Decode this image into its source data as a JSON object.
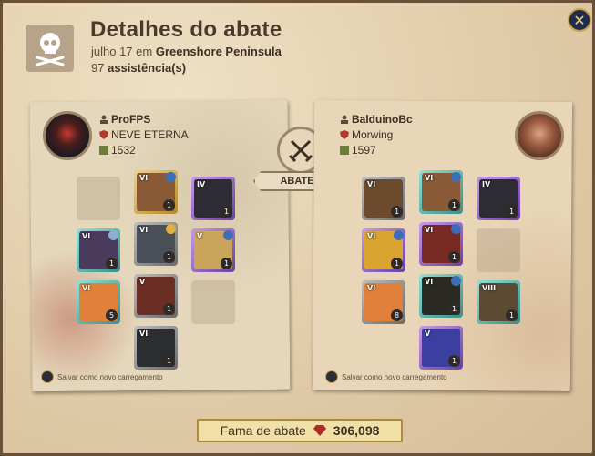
{
  "header": {
    "title": "Detalhes do abate",
    "date_location_prefix": "julho 17 em",
    "location": "Greenshore Peninsula",
    "assist_count": "97",
    "assist_label": "assistência(s)"
  },
  "killer": {
    "name": "ProFPS",
    "guild": "NEVE ETERNA",
    "ip": "1532",
    "save_loadout": "Salvar como novo carregamento"
  },
  "victim": {
    "name": "BalduinoBc",
    "guild": "Morwing",
    "ip": "1597",
    "save_loadout": "Salvar como novo carregamento"
  },
  "center": {
    "abateu_label": "ABATEU"
  },
  "fame": {
    "label": "Fama de abate",
    "value": "306,098"
  },
  "icons": {
    "close": "close-icon",
    "skull": "skull-crossbones-icon",
    "swords": "crossed-swords-icon"
  },
  "colors": {
    "parchment": "#e6d3b4",
    "ink": "#3d2e22",
    "gold_border": "#c9a24a"
  },
  "killer_items": [
    {
      "slot": "bag",
      "tier": "",
      "qty": "",
      "quality": "empty"
    },
    {
      "slot": "head",
      "tier": "VI",
      "qty": "1",
      "quality": "gold"
    },
    {
      "slot": "cape",
      "tier": "IV",
      "qty": "1",
      "quality": "purple"
    },
    {
      "slot": "mainhand",
      "tier": "VI",
      "qty": "1",
      "quality": "teal"
    },
    {
      "slot": "armor",
      "tier": "VI",
      "qty": "1",
      "quality": "gray"
    },
    {
      "slot": "offhand",
      "tier": "V",
      "qty": "1",
      "quality": "purple"
    },
    {
      "slot": "potion",
      "tier": "VI",
      "qty": "5",
      "quality": "teal"
    },
    {
      "slot": "shoes",
      "tier": "V",
      "qty": "1",
      "quality": "gray"
    },
    {
      "slot": "food",
      "tier": "",
      "qty": "",
      "quality": "empty"
    },
    {
      "slot": "mount",
      "tier": "VI",
      "qty": "1",
      "quality": "gray"
    }
  ],
  "victim_items": [
    {
      "slot": "bag",
      "tier": "VI",
      "qty": "1",
      "quality": "gray"
    },
    {
      "slot": "head",
      "tier": "VI",
      "qty": "1",
      "quality": "teal"
    },
    {
      "slot": "cape",
      "tier": "IV",
      "qty": "1",
      "quality": "purple"
    },
    {
      "slot": "mainhand",
      "tier": "VI",
      "qty": "1",
      "quality": "purple"
    },
    {
      "slot": "armor",
      "tier": "VI",
      "qty": "1",
      "quality": "purple"
    },
    {
      "slot": "offhand",
      "tier": "",
      "qty": "",
      "quality": "empty"
    },
    {
      "slot": "potion",
      "tier": "VI",
      "qty": "8",
      "quality": "gray"
    },
    {
      "slot": "shoes",
      "tier": "VI",
      "qty": "1",
      "quality": "teal"
    },
    {
      "slot": "food",
      "tier": "VIII",
      "qty": "1",
      "quality": "teal"
    },
    {
      "slot": "mount",
      "tier": "V",
      "qty": "1",
      "quality": "purple"
    }
  ]
}
